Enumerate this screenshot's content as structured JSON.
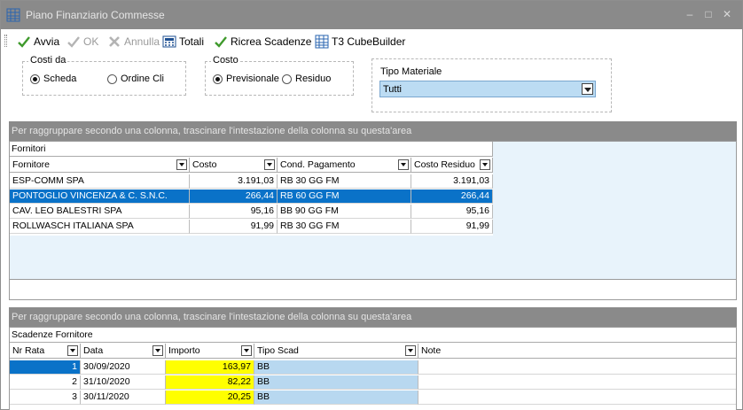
{
  "window": {
    "title": "Piano Finanziario Commesse"
  },
  "toolbar": {
    "avvia": "Avvia",
    "ok": "OK",
    "annulla": "Annulla",
    "totali": "Totali",
    "ricrea": "Ricrea Scadenze",
    "cube": "T3 CubeBuilder"
  },
  "filters": {
    "costi_da": {
      "legend": "Costi da",
      "opt1": "Scheda",
      "opt2": "Ordine Cli",
      "selected": "Scheda"
    },
    "costo": {
      "legend": "Costo",
      "opt1": "Previsionale",
      "opt2": "Residuo",
      "selected": "Previsionale"
    },
    "tipo_materiale": {
      "label": "Tipo Materiale",
      "value": "Tutti"
    }
  },
  "group_panel_text": "Per raggruppare secondo una colonna, trascinare l'intestazione della colonna su questa'area",
  "fornitori": {
    "band": "Fornitori",
    "columns": [
      "Fornitore",
      "Costo",
      "Cond. Pagamento",
      "Costo Residuo"
    ],
    "rows": [
      [
        "ESP-COMM SPA",
        "3.191,03",
        "RB 30 GG FM",
        "3.191,03"
      ],
      [
        "PONTOGLIO VINCENZA & C. S.N.C.",
        "266,44",
        "RB 60 GG FM",
        "266,44"
      ],
      [
        "CAV. LEO BALESTRI SPA",
        "95,16",
        "BB 90 GG FM",
        "95,16"
      ],
      [
        "ROLLWASCH ITALIANA SPA",
        "91,99",
        "RB 30 GG FM",
        "91,99"
      ]
    ]
  },
  "scadenze": {
    "band": "Scadenze Fornitore",
    "columns": [
      "Nr Rata",
      "Data",
      "Importo",
      "Tipo Scad",
      "Note"
    ],
    "rows": [
      [
        "1",
        "30/09/2020",
        "163,97",
        "BB",
        ""
      ],
      [
        "2",
        "31/10/2020",
        "82,22",
        "BB",
        ""
      ],
      [
        "3",
        "30/11/2020",
        "20,25",
        "BB",
        ""
      ]
    ]
  },
  "colors": {
    "titlebar": "#8a8a8a",
    "selection": "#0a72c8",
    "highlight_yellow": "#ffff00",
    "light_blue": "#b8d8f0"
  }
}
